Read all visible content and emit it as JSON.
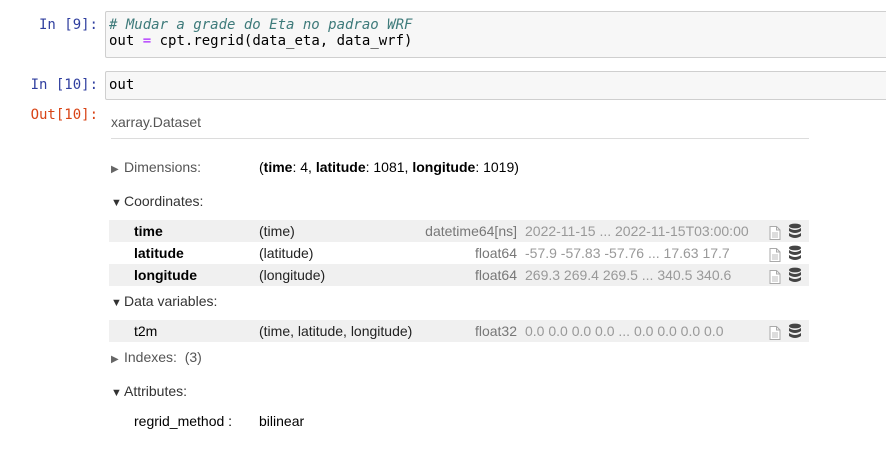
{
  "cells": [
    {
      "prompt": "In [9]:",
      "lines": [
        {
          "comment": "# Mudar a grade do Eta no padrao WRF"
        },
        {
          "lhs": "out",
          "op": "=",
          "rhs": "cpt.regrid(data_eta, data_wrf)"
        }
      ]
    },
    {
      "prompt": "In [10]:",
      "code": "out"
    }
  ],
  "output": {
    "prompt": "Out[10]:",
    "type_label": "xarray.Dataset",
    "dimensions": {
      "label": "Dimensions:",
      "items": [
        {
          "name": "time",
          "value": "4"
        },
        {
          "name": "latitude",
          "value": "1081"
        },
        {
          "name": "longitude",
          "value": "1019"
        }
      ]
    },
    "coordinates": {
      "label": "Coordinates:",
      "rows": [
        {
          "name": "time",
          "dims": "(time)",
          "dtype": "datetime64[ns]",
          "preview": "2022-11-15 ... 2022-11-15T03:00:00"
        },
        {
          "name": "latitude",
          "dims": "(latitude)",
          "dtype": "float64",
          "preview": "-57.9 -57.83 -57.76 ... 17.63 17.7"
        },
        {
          "name": "longitude",
          "dims": "(longitude)",
          "dtype": "float64",
          "preview": "269.3 269.4 269.5 ... 340.5 340.6"
        }
      ]
    },
    "data_variables": {
      "label": "Data variables:",
      "rows": [
        {
          "name": "t2m",
          "dims": "(time, latitude, longitude)",
          "dtype": "float32",
          "preview": "0.0 0.0 0.0 0.0 ... 0.0 0.0 0.0 0.0"
        }
      ]
    },
    "indexes": {
      "label": "Indexes:",
      "count": "(3)"
    },
    "attributes": {
      "label": "Attributes:",
      "rows": [
        {
          "key": "regrid_method :",
          "value": "bilinear"
        }
      ]
    }
  }
}
